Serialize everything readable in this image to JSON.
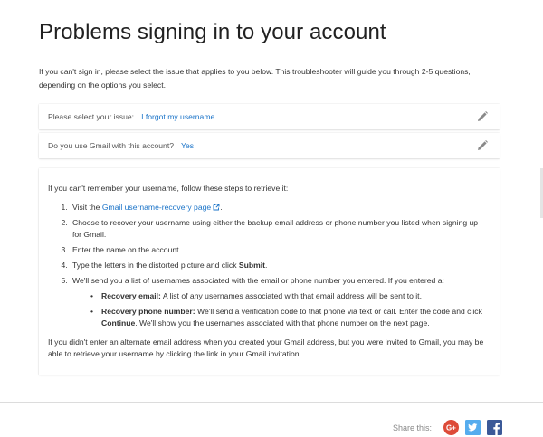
{
  "page": {
    "title": "Problems signing in to your account",
    "intro": "If you can't sign in, please select the issue that applies to you below. This troubleshooter will guide you through 2-5 questions, depending on the options you select."
  },
  "questions": [
    {
      "label": "Please select your issue:",
      "answer": "I forgot my username",
      "edit_icon": "pencil-icon"
    },
    {
      "label": "Do you use Gmail with this account?",
      "answer": "Yes",
      "edit_icon": "pencil-icon"
    }
  ],
  "answer": {
    "lead": "If you can't remember your username, follow these steps to retrieve it:",
    "step1_prefix": "Visit the ",
    "step1_link": "Gmail username-recovery page",
    "step1_suffix": ".",
    "step2": "Choose to recover your username using either the backup email address or phone number you listed when signing up for Gmail.",
    "step3": "Enter the name on the account.",
    "step4_prefix": "Type the letters in the distorted picture and click ",
    "step4_bold": "Submit",
    "step4_suffix": ".",
    "step5": "We'll send you a list of usernames associated with the email or phone number you entered. If you entered a:",
    "bullet1_bold": "Recovery email:",
    "bullet1_text": " A list of any usernames associated with that email address will be sent to it.",
    "bullet2_bold": "Recovery phone number:",
    "bullet2_text_a": " We'll send a verification code to that phone via text or call. Enter the code and click ",
    "bullet2_bold2": "Continue",
    "bullet2_text_b": ". We'll show you the usernames associated with that phone number on the next page.",
    "footer": "If you didn't enter an alternate email address when you created your Gmail address, but you were invited to Gmail, you may be able to retrieve your username by clicking the link in your Gmail invitation."
  },
  "share": {
    "label": "Share this:",
    "gplus_text": "G+",
    "buttons": [
      "google-plus-icon",
      "twitter-icon",
      "facebook-icon"
    ],
    "colors": {
      "gplus": "#dd4b39",
      "twitter": "#55acee",
      "facebook": "#3b5998"
    }
  },
  "colors": {
    "link": "#1a73c8",
    "text": "#212121"
  }
}
